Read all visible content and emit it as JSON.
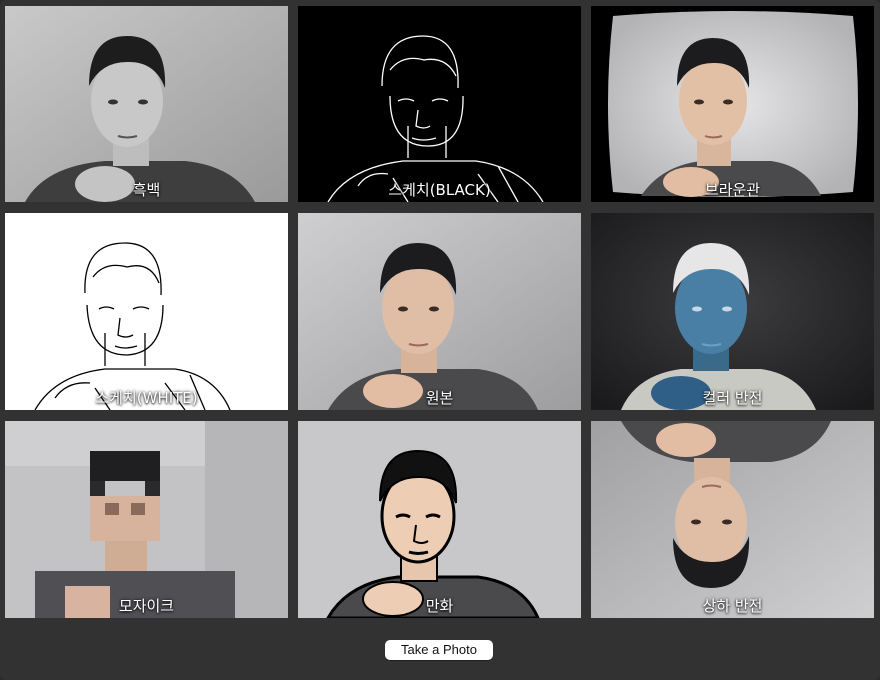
{
  "filters": [
    {
      "id": "gray",
      "label": "흑백"
    },
    {
      "id": "sketch-black",
      "label": "스케치(BLACK)"
    },
    {
      "id": "crt",
      "label": "브라운관"
    },
    {
      "id": "sketch-white",
      "label": "스케치(WHITE)"
    },
    {
      "id": "original",
      "label": "원본"
    },
    {
      "id": "invert",
      "label": "컬러 반전"
    },
    {
      "id": "mosaic",
      "label": "모자이크"
    },
    {
      "id": "cartoon",
      "label": "만화"
    },
    {
      "id": "flip",
      "label": "상하 반전"
    }
  ],
  "capture_button": {
    "label": "Take a Photo"
  }
}
